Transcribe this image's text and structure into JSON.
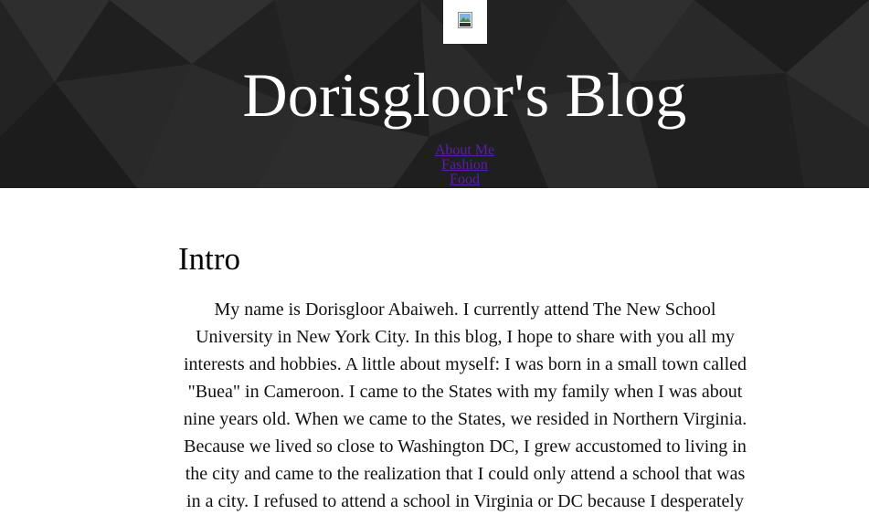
{
  "header": {
    "logo_icon": "broken-image-icon",
    "title": "Dorisgloor's Blog",
    "nav": [
      {
        "label": "About Me"
      },
      {
        "label": "Fashion"
      },
      {
        "label": "Food"
      }
    ],
    "colors": {
      "background": "#262626",
      "title": "#ffffff",
      "link": "#5a1fa8"
    }
  },
  "main": {
    "section_title": "Intro",
    "body": "My name is Dorisgloor Abaiweh. I currently attend The New School University in New York City. In this blog, I hope to share with you all my interests and hobbies. A little about myself: I was born in a small town called \"Buea\" in Cameroon. I came to the States with my family when I was about nine years old. When we came to the States, we resided in Northern Virginia. Because we lived so close to Washington DC, I grew accustomed to living in the city and came to the realization that I could only attend a school that was in a city. I refused to attend a school in Virginia or DC because I desperately"
  }
}
